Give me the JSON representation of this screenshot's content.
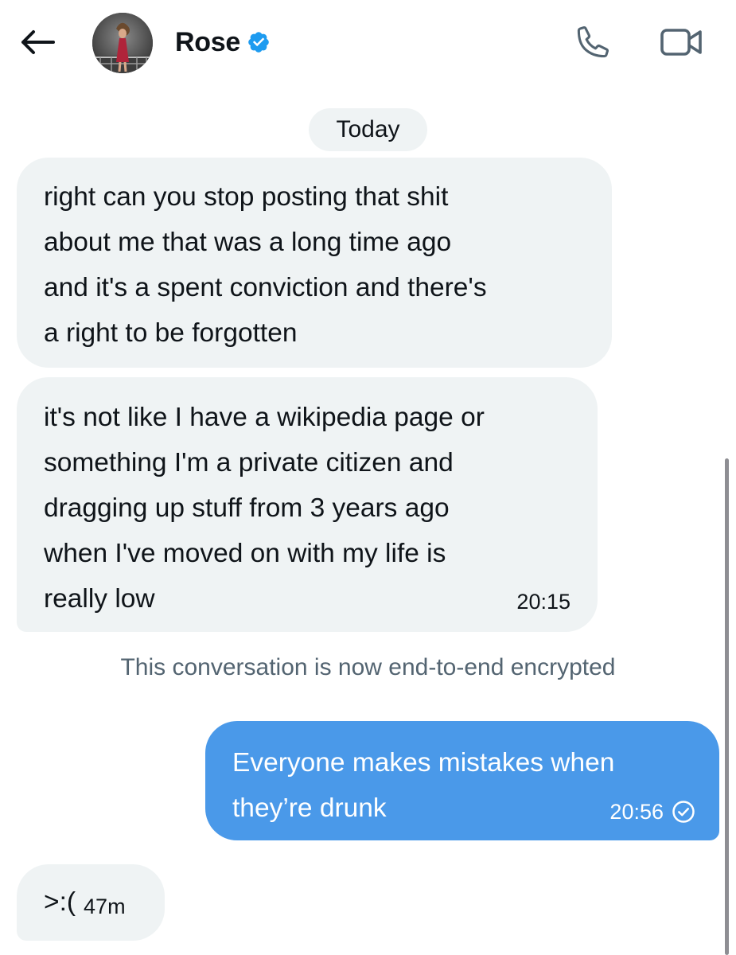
{
  "header": {
    "contact_name": "Rose",
    "verified": true,
    "icons": {
      "back": "arrow-left-icon",
      "verified": "verified-badge-icon",
      "call": "phone-icon",
      "video": "video-camera-icon"
    }
  },
  "conversation": {
    "date_divider": "Today",
    "messages": [
      {
        "direction": "incoming",
        "text": "right can you stop posting that shit\nabout me that was a long time ago\nand it's a spent conviction and there's\na right to be forgotten",
        "time": ""
      },
      {
        "direction": "incoming",
        "text": "it's not like I have a wikipedia page or\nsomething I'm a private citizen and\ndragging up stuff from 3 years ago\nwhen I've moved on with my life is\nreally low",
        "time": "20:15"
      },
      {
        "direction": "outgoing",
        "text": "Everyone makes mistakes when\nthey’re drunk",
        "time": "20:56",
        "status_icon": "seen-check-icon"
      },
      {
        "direction": "incoming",
        "text": ">:(",
        "time": "47m"
      }
    ],
    "system_note": "This conversation is now end-to-end encrypted"
  },
  "colors": {
    "incoming_bubble": "#eff3f4",
    "outgoing_bubble": "#4a99e9",
    "verified_blue": "#1d9bf0",
    "muted_text": "#536471"
  }
}
